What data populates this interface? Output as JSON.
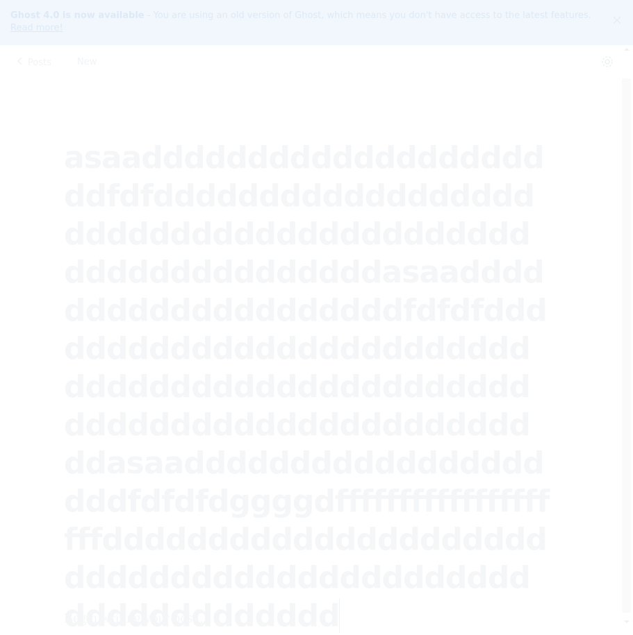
{
  "notice": {
    "headline": "Ghost 4.0 is now available",
    "message": " - You are using an old version of Ghost, which means you don't have access to the latest features. ",
    "link_text": "Read more!",
    "close_icon": "close-icon"
  },
  "header": {
    "back_label": "Posts",
    "back_icon": "chevron-left-icon",
    "status": "New",
    "settings_icon": "gear-icon"
  },
  "editor": {
    "title_text": "asaadddddddddddddddddddddfdfdddddddddddddddddddddddddddddddddddddddddddddddddddddddasaaddddddddddddddddddddfdfdfdddddddddddddddddddddddddddddddddddddddddddddddddddddddddddddddddddddddasaaddddddddddddddddddddfdfdfdggggdffffffffffffffffffffdddddddddddddddddddddddddddddddddddddddddddddddddddddddd",
    "body_placeholder": "Begin writing your post..."
  },
  "colors": {
    "notice_bg": "#f2f7fd",
    "notice_text": "#dde9f6",
    "title_text": "#f5f6f7"
  }
}
